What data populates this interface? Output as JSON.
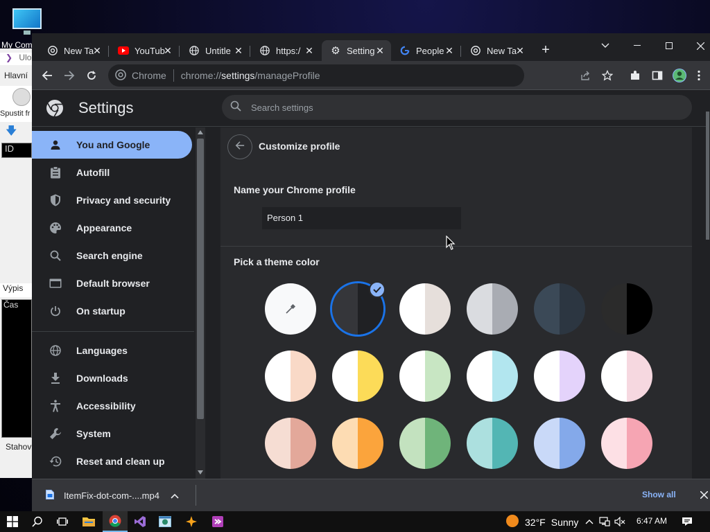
{
  "desktop": {
    "icon_label": "My Com",
    "icon_name": "computer-icon"
  },
  "background_app": {
    "label_ulo": "Ulo",
    "label_hlavni": "Hlavní",
    "label_spustit": "Spustit fr",
    "label_id": "ID",
    "label_vypis": "Výpis",
    "label_cas": "Čas",
    "label_stahov": "Stahov"
  },
  "tabs": [
    {
      "title": "New Ta",
      "icon": "chrome-icon"
    },
    {
      "title": "YouTub",
      "icon": "youtube-icon"
    },
    {
      "title": "Untitle",
      "icon": "globe-icon"
    },
    {
      "title": "https:/",
      "icon": "globe-icon"
    },
    {
      "title": "Setting",
      "icon": "gear-icon",
      "active": true
    },
    {
      "title": "People",
      "icon": "google-icon"
    },
    {
      "title": "New Ta",
      "icon": "chrome-icon"
    }
  ],
  "toolbar": {
    "site_label": "Chrome",
    "url_prefix": "chrome://",
    "url_host": "settings",
    "url_path": "/manageProfile"
  },
  "settings": {
    "title": "Settings",
    "search_placeholder": "Search settings",
    "nav": [
      {
        "label": "You and Google",
        "icon": "person-icon",
        "selected": true
      },
      {
        "label": "Autofill",
        "icon": "clipboard-icon"
      },
      {
        "label": "Privacy and security",
        "icon": "shield-icon"
      },
      {
        "label": "Appearance",
        "icon": "palette-icon"
      },
      {
        "label": "Search engine",
        "icon": "search-icon"
      },
      {
        "label": "Default browser",
        "icon": "browser-icon"
      },
      {
        "label": "On startup",
        "icon": "power-icon"
      },
      {
        "label": "Languages",
        "icon": "globe-icon"
      },
      {
        "label": "Downloads",
        "icon": "download-icon"
      },
      {
        "label": "Accessibility",
        "icon": "accessibility-icon"
      },
      {
        "label": "System",
        "icon": "wrench-icon"
      },
      {
        "label": "Reset and clean up",
        "icon": "history-icon"
      }
    ]
  },
  "customize_profile": {
    "title": "Customize profile",
    "name_label": "Name your Chrome profile",
    "name_value": "Person 1",
    "theme_label": "Pick a theme color",
    "selected_theme_index": 1,
    "theme_colors": [
      {
        "left": "#f8f9fa",
        "right": "#f8f9fa",
        "picker": true
      },
      {
        "left": "#35363a",
        "right": "#202124"
      },
      {
        "left": "#ffffff",
        "right": "#e6dfdb"
      },
      {
        "left": "#dadce0",
        "right": "#a9acb3"
      },
      {
        "left": "#3b4957",
        "right": "#2c3641"
      },
      {
        "left": "#2b2b2b",
        "right": "#000000"
      },
      {
        "left": "#ffffff",
        "right": "#f9d9c7"
      },
      {
        "left": "#ffffff",
        "right": "#fcdb58"
      },
      {
        "left": "#ffffff",
        "right": "#c8e6c3"
      },
      {
        "left": "#ffffff",
        "right": "#b2e6ef"
      },
      {
        "left": "#ffffff",
        "right": "#e4d3fb"
      },
      {
        "left": "#ffffff",
        "right": "#f6d8e0"
      },
      {
        "left": "#f6ddd3",
        "right": "#e3a89a"
      },
      {
        "left": "#fddcb3",
        "right": "#fba43c"
      },
      {
        "left": "#c3e2bf",
        "right": "#6fb47a"
      },
      {
        "left": "#ace0df",
        "right": "#53b6b4"
      },
      {
        "left": "#c9d9f8",
        "right": "#84a9ea"
      },
      {
        "left": "#fde0e5",
        "right": "#f6a5b3"
      }
    ]
  },
  "download_bar": {
    "file_name": "ItemFix-dot-com-....mp4",
    "show_all_label": "Show all"
  },
  "taskbar": {
    "temperature": "32°F",
    "condition": "Sunny",
    "time": "6:47 AM"
  },
  "colors": {
    "accent": "#8ab4f8",
    "page_bg": "#202124",
    "card_bg": "#292a2d"
  }
}
